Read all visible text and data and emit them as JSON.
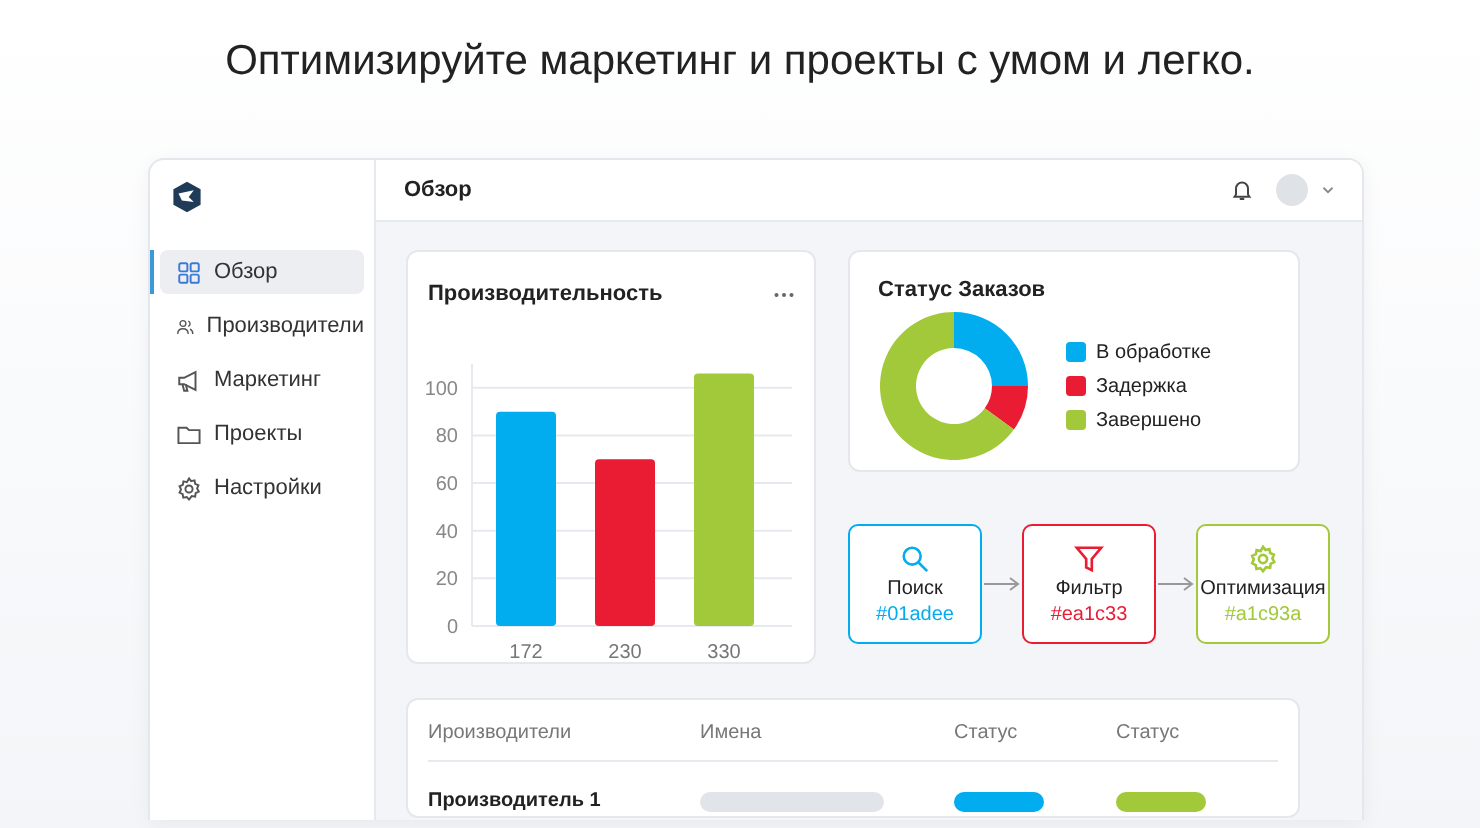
{
  "headline": "Оптимизируйте маркетинг и проекты с умом и легко.",
  "sidebar": {
    "items": [
      {
        "label": "Обзор",
        "kind": "grid",
        "selected": true
      },
      {
        "label": "Производители",
        "kind": "users",
        "selected": false
      },
      {
        "label": "Маркетинг",
        "kind": "megaphone",
        "selected": false
      },
      {
        "label": "Проекты",
        "kind": "folder",
        "selected": false
      },
      {
        "label": "Настройки",
        "kind": "gear",
        "selected": false
      }
    ]
  },
  "header": {
    "title": "Обзор"
  },
  "performance": {
    "title": "Производительность",
    "chart_data": {
      "type": "bar",
      "categories": [
        "172",
        "230",
        "330"
      ],
      "values": [
        90,
        70,
        106
      ],
      "colors": [
        "#01adee",
        "#ea1c33",
        "#a1c93a"
      ],
      "ylim": [
        0,
        110
      ],
      "yticks": [
        0,
        20,
        40,
        60,
        80,
        100
      ],
      "grid": true
    }
  },
  "orders": {
    "title": "Статус Заказов",
    "legend": [
      {
        "label": "В обработке",
        "color": "#01adee"
      },
      {
        "label": "Задержка",
        "color": "#ea1c33"
      },
      {
        "label": "Завершено",
        "color": "#a1c93a"
      }
    ]
  },
  "flow": [
    {
      "kind": "search",
      "label": "Поиск",
      "code": "#01adee",
      "color": "#01adee"
    },
    {
      "kind": "filter",
      "label": "Фильтр",
      "code": "#ea1c33",
      "color": "#ea1c33"
    },
    {
      "kind": "gear",
      "label": "Оптимизация",
      "code": "#a1c93a",
      "color": "#a1c93a"
    }
  ],
  "table": {
    "columns": [
      "Ироизводители",
      "Имена",
      "Статус",
      "Статус"
    ],
    "rows": [
      {
        "name": "Производитель 1",
        "statuses": [
          {
            "color": "#01adee"
          },
          {
            "color": "#a1c93a"
          }
        ]
      }
    ]
  }
}
